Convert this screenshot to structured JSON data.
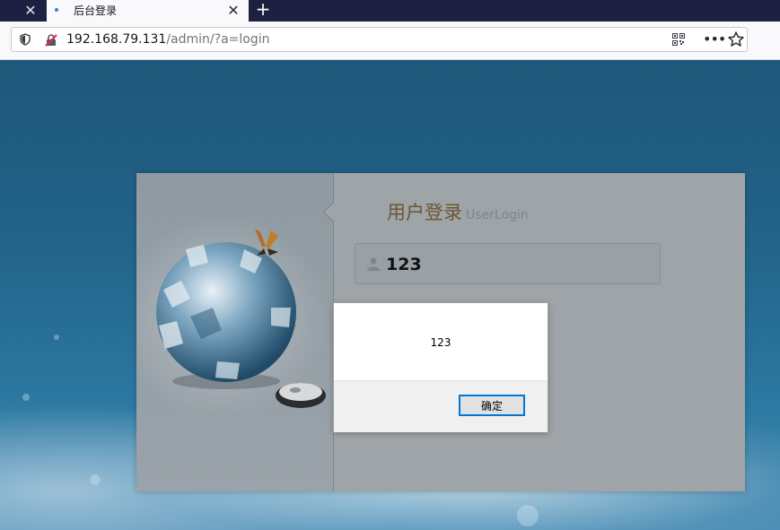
{
  "browser": {
    "prev_tab_close": "✕",
    "tab": {
      "title": "后台登录",
      "close": "✕"
    },
    "new_tab": "+",
    "url": {
      "host": "192.168.79.131",
      "path": "/admin/?a=login"
    },
    "more": "•••"
  },
  "login": {
    "title": "用户登录",
    "title_en": "UserLogin",
    "username_value": "123"
  },
  "dialog": {
    "message": "123",
    "ok_label": "确定"
  },
  "colors": {
    "accent": "#0078d7",
    "tab_bar": "#1e2041",
    "title_brown": "#6e5530"
  }
}
